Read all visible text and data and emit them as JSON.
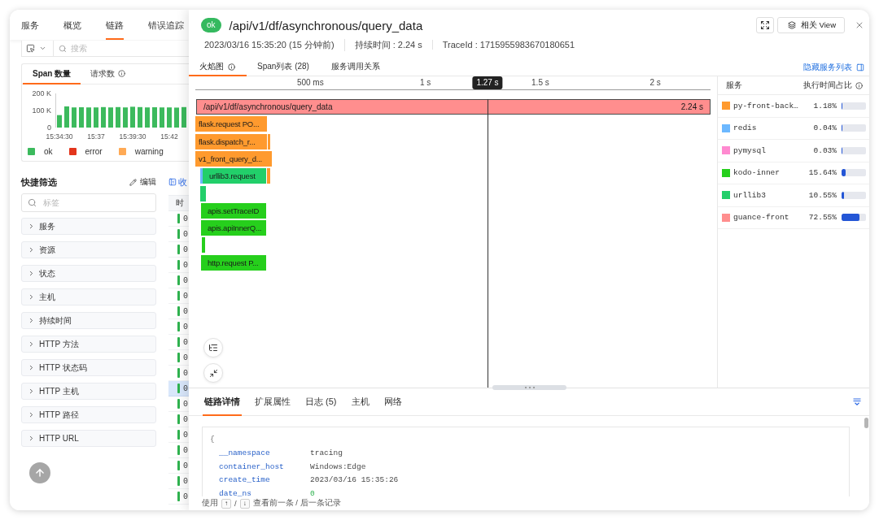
{
  "nav": {
    "tabs": [
      {
        "label": "服务",
        "selected": false
      },
      {
        "label": "概览",
        "selected": false
      },
      {
        "label": "链路",
        "selected": true
      },
      {
        "label": "错误追踪",
        "selected": false
      }
    ]
  },
  "search": {
    "placeholder": "搜索"
  },
  "chart_card": {
    "tabs": [
      {
        "label": "Span 数量",
        "selected": true,
        "info": false
      },
      {
        "label": "请求数",
        "selected": false,
        "info": true
      }
    ],
    "chart_data": {
      "type": "bar",
      "categories": [
        "15:34:30",
        null,
        null,
        null,
        null,
        "15:37",
        null,
        null,
        null,
        null,
        "15:39:30",
        null,
        null,
        null,
        null,
        "15:42",
        null,
        null
      ],
      "ylim": [
        0,
        200000
      ],
      "yticks": [
        {
          "value": 0,
          "label": "0"
        },
        {
          "value": 100000,
          "label": "100 K"
        },
        {
          "value": 200000,
          "label": "200 K"
        }
      ],
      "series": [
        {
          "name": "ok",
          "color": "#3cba5d",
          "values": [
            73000,
            124000,
            118000,
            119000,
            118000,
            118000,
            120000,
            118000,
            120000,
            118000,
            122000,
            120000,
            118000,
            119000,
            118000,
            118000,
            117000,
            120000
          ]
        }
      ]
    },
    "legend": [
      {
        "label": "error",
        "color": "#e3351c"
      },
      {
        "label": "warning",
        "color": "#ffaa55"
      }
    ]
  },
  "quick_filter": {
    "title": "快捷筛选",
    "edit": "编辑",
    "search": {
      "placeholder": "标签"
    },
    "items": [
      {
        "label": "服务",
        "expanded": false
      },
      {
        "label": "资源",
        "expanded": false
      },
      {
        "label": "状态",
        "expanded": false
      },
      {
        "label": "主机",
        "expanded": false
      },
      {
        "label": "持续时间",
        "expanded": false
      },
      {
        "label": "HTTP 方法",
        "expanded": false
      },
      {
        "label": "HTTP 状态码",
        "expanded": false
      },
      {
        "label": "HTTP 主机",
        "expanded": false
      },
      {
        "label": "HTTP 路径",
        "expanded": false
      },
      {
        "label": "HTTP URL",
        "expanded": false
      }
    ]
  },
  "table": {
    "collapse_label": "收",
    "columns": [
      "时"
    ],
    "rows": [
      {
        "cells": [
          "0"
        ],
        "selected": false
      },
      {
        "cells": [
          "0"
        ],
        "selected": false
      },
      {
        "cells": [
          "0"
        ],
        "selected": false
      },
      {
        "cells": [
          "0"
        ],
        "selected": false
      },
      {
        "cells": [
          "0"
        ],
        "selected": false
      },
      {
        "cells": [
          "0"
        ],
        "selected": false
      },
      {
        "cells": [
          "0"
        ],
        "selected": false
      },
      {
        "cells": [
          "0"
        ],
        "selected": false
      },
      {
        "cells": [
          "0"
        ],
        "selected": false
      },
      {
        "cells": [
          "0"
        ],
        "selected": false
      },
      {
        "cells": [
          "0"
        ],
        "selected": false
      },
      {
        "cells": [
          "0"
        ],
        "selected": true
      },
      {
        "cells": [
          "0"
        ],
        "selected": false
      },
      {
        "cells": [
          "0"
        ],
        "selected": false
      },
      {
        "cells": [
          "0"
        ],
        "selected": false
      },
      {
        "cells": [
          "0"
        ],
        "selected": false
      },
      {
        "cells": [
          "0"
        ],
        "selected": false
      },
      {
        "cells": [
          "0"
        ],
        "selected": false
      },
      {
        "cells": [
          "0"
        ],
        "selected": false
      }
    ]
  },
  "drawer": {
    "status": {
      "label": "ok",
      "kind": "ok"
    },
    "title": "/api/v1/df/asynchronous/query_data",
    "related_view": "相关 View",
    "meta": [
      "2023/03/16 15:35:20 (15 分钟前)",
      "持续时间 : 2.24 s",
      "TraceId : 1715955983670180651"
    ],
    "tabs": [
      {
        "label": "火焰图",
        "selected": true,
        "info": true
      },
      {
        "label": "Span列表 (28)",
        "selected": false,
        "info": false
      },
      {
        "label": "服务调用关系",
        "selected": false,
        "info": false
      }
    ],
    "hide_link": "隐藏服务列表",
    "flame_graph": {
      "ticks": [
        "500 ms",
        "1 s",
        "1.5 s",
        "2 s"
      ],
      "cursor": "1.27 s",
      "spans": [
        {
          "label": "/api/v1/df/asynchronous/query_data",
          "duration": "2.24 s",
          "color": "#ff8e8e",
          "selected": true
        },
        {
          "label": "flask.request PO...",
          "color": "#ff9a2e",
          "selected": false
        },
        {
          "label": "flask.dispatch_r...",
          "color": "#ff9a2e",
          "selected": false
        },
        {
          "color": "#ff9a2e",
          "selected": false
        },
        {
          "label": "v1_front_query_d...",
          "color": "#ff9a2e",
          "selected": false
        },
        {
          "color": "#6cb8ff",
          "selected": false
        },
        {
          "label": "urllib3.request",
          "color": "#22cf6a",
          "selected": false
        },
        {
          "color": "#ff9a2e",
          "selected": false
        },
        {
          "color": "#22cf6a",
          "selected": false
        },
        {
          "label": "apis.setTraceID",
          "color": "#26cf1c",
          "selected": false
        },
        {
          "label": "apis.apiInnerQ...",
          "color": "#26cf1c",
          "selected": false
        },
        {
          "color": "#26cf1c",
          "selected": false
        },
        {
          "label": "http.request P...",
          "color": "#26cf1c",
          "selected": false
        }
      ]
    },
    "services": {
      "columns": [
        {
          "label": "服务",
          "info": false
        },
        {
          "label": "执行时间占比",
          "info": true
        }
      ],
      "rows": [
        {
          "name": "py-front-back…",
          "color": "#ff9a2e",
          "share": "1.18%",
          "level": 0.0118
        },
        {
          "name": "redis",
          "color": "#6cb8ff",
          "share": "0.04%",
          "level": 0.0004
        },
        {
          "name": "pymysql",
          "color": "#ff8ad0",
          "share": "0.03%",
          "level": 0.0003
        },
        {
          "name": "kodo-inner",
          "color": "#26cf1c",
          "share": "15.64%",
          "level": 0.1564
        },
        {
          "name": "urllib3",
          "color": "#22cf6a",
          "share": "10.55%",
          "level": 0.1055
        },
        {
          "name": "guance-front",
          "color": "#ff8e8e",
          "share": "72.55%",
          "level": 0.7255
        }
      ]
    },
    "detail": {
      "tabs": [
        {
          "label": "链路详情",
          "selected": true
        },
        {
          "label": "扩展属性",
          "selected": false
        },
        {
          "label": "日志 (5)",
          "selected": false
        },
        {
          "label": "主机",
          "selected": false
        },
        {
          "label": "网络",
          "selected": false
        }
      ],
      "open_brace": "{",
      "fields": [
        {
          "key": "__namespace",
          "value": "tracing",
          "kind": "string"
        },
        {
          "key": "container_host",
          "value": "Windows:Edge",
          "kind": "string"
        },
        {
          "key": "create_time",
          "value": "2023/03/16 15:35:26",
          "kind": "string"
        },
        {
          "key": "date_ns",
          "value": "0",
          "kind": "number"
        }
      ],
      "hint": {
        "lead": "使用",
        "keys": [
          "↑",
          "↓"
        ],
        "separator": "/",
        "text": "查看前一条 / 后一条记录"
      }
    }
  }
}
